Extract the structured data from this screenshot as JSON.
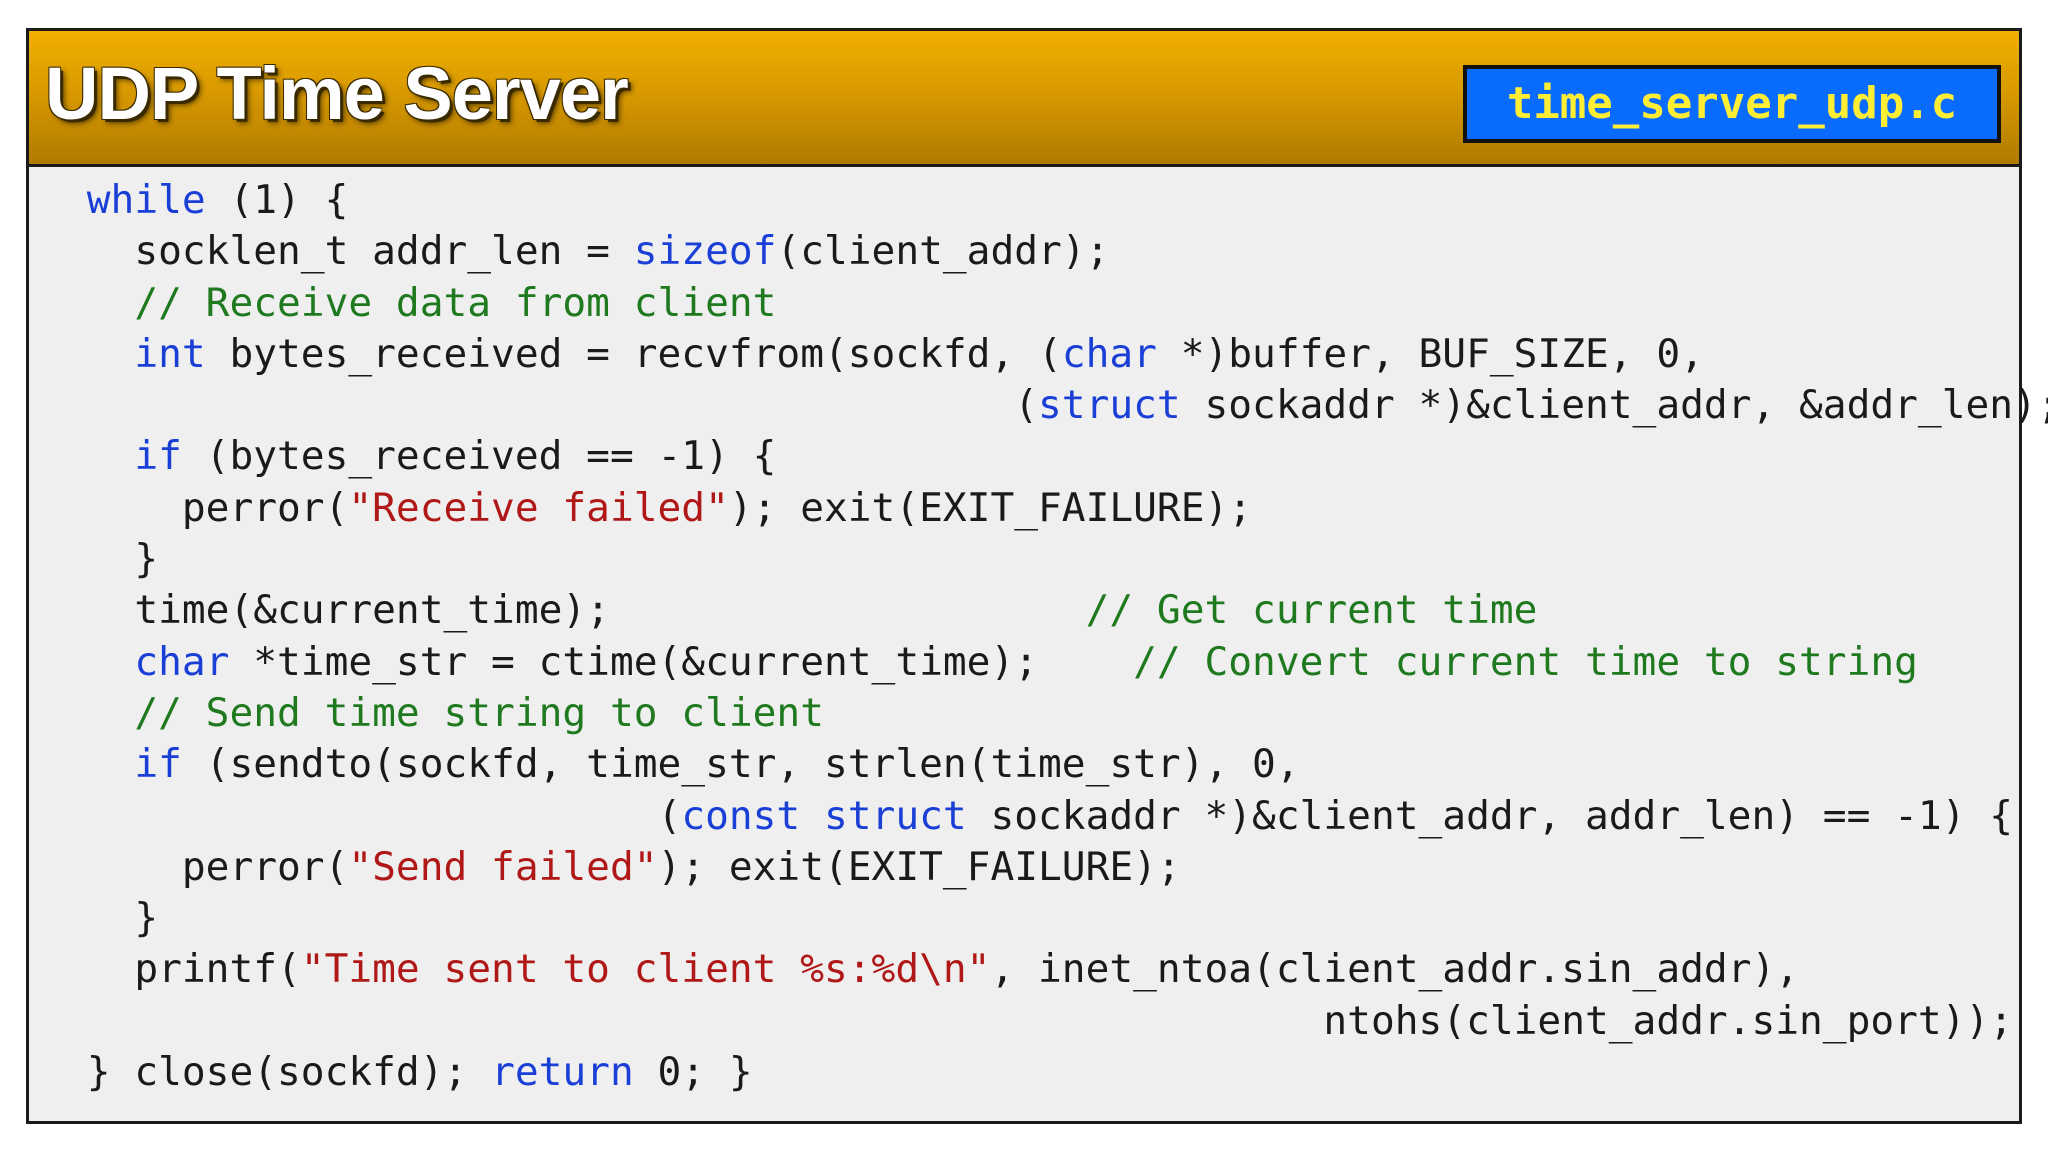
{
  "header": {
    "title": "UDP Time Server",
    "filename": "time_server_udp.c"
  },
  "colors": {
    "header_gold": "#e0a200",
    "filename_bg": "#0a6cff",
    "filename_text": "#ffee33",
    "keyword": "#1a3fd6",
    "comment": "#1f7a1f",
    "string": "#b01818",
    "text": "#1a1a1a",
    "code_bg": "#efefef"
  },
  "code": {
    "lines": [
      [
        {
          "t": "kw",
          "s": " while"
        },
        {
          "t": "tx",
          "s": " (1) {"
        }
      ],
      [
        {
          "t": "tx",
          "s": "   socklen_t addr_len = "
        },
        {
          "t": "kw",
          "s": "sizeof"
        },
        {
          "t": "tx",
          "s": "(client_addr);"
        }
      ],
      [
        {
          "t": "cm",
          "s": "   // Receive data from client"
        }
      ],
      [
        {
          "t": "kw",
          "s": "   int"
        },
        {
          "t": "tx",
          "s": " bytes_received = recvfrom(sockfd, ("
        },
        {
          "t": "kw",
          "s": "char"
        },
        {
          "t": "tx",
          "s": " *)buffer, BUF_SIZE, 0,"
        }
      ],
      [
        {
          "t": "tx",
          "s": "                                        ("
        },
        {
          "t": "kw",
          "s": "struct"
        },
        {
          "t": "tx",
          "s": " sockaddr *)&client_addr, &addr_len);"
        }
      ],
      [
        {
          "t": "kw",
          "s": "   if"
        },
        {
          "t": "tx",
          "s": " (bytes_received == -1) {"
        }
      ],
      [
        {
          "t": "tx",
          "s": "     perror("
        },
        {
          "t": "st",
          "s": "\"Receive failed\""
        },
        {
          "t": "tx",
          "s": "); exit(EXIT_FAILURE);"
        }
      ],
      [
        {
          "t": "tx",
          "s": "   }"
        }
      ],
      [
        {
          "t": "tx",
          "s": "   time(&current_time);                    "
        },
        {
          "t": "cm",
          "s": "// Get current time"
        }
      ],
      [
        {
          "t": "kw",
          "s": "   char"
        },
        {
          "t": "tx",
          "s": " *time_str = ctime(&current_time);    "
        },
        {
          "t": "cm",
          "s": "// Convert current time to string"
        }
      ],
      [
        {
          "t": "cm",
          "s": "   // Send time string to client"
        }
      ],
      [
        {
          "t": "kw",
          "s": "   if"
        },
        {
          "t": "tx",
          "s": " (sendto(sockfd, time_str, strlen(time_str), 0,"
        }
      ],
      [
        {
          "t": "tx",
          "s": "                         ("
        },
        {
          "t": "kw",
          "s": "const"
        },
        {
          "t": "tx",
          "s": " "
        },
        {
          "t": "kw",
          "s": "struct"
        },
        {
          "t": "tx",
          "s": " sockaddr *)&client_addr, addr_len) == -1) {"
        }
      ],
      [
        {
          "t": "tx",
          "s": "     perror("
        },
        {
          "t": "st",
          "s": "\"Send failed\""
        },
        {
          "t": "tx",
          "s": "); exit(EXIT_FAILURE);"
        }
      ],
      [
        {
          "t": "tx",
          "s": "   }"
        }
      ],
      [
        {
          "t": "tx",
          "s": "   printf("
        },
        {
          "t": "st",
          "s": "\"Time sent to client %s:%d\\n\""
        },
        {
          "t": "tx",
          "s": ", inet_ntoa(client_addr.sin_addr),"
        }
      ],
      [
        {
          "t": "tx",
          "s": "                                                     ntohs(client_addr.sin_port));"
        }
      ],
      [
        {
          "t": "tx",
          "s": " } close(sockfd); "
        },
        {
          "t": "kw",
          "s": "return"
        },
        {
          "t": "tx",
          "s": " 0; }"
        }
      ]
    ]
  }
}
